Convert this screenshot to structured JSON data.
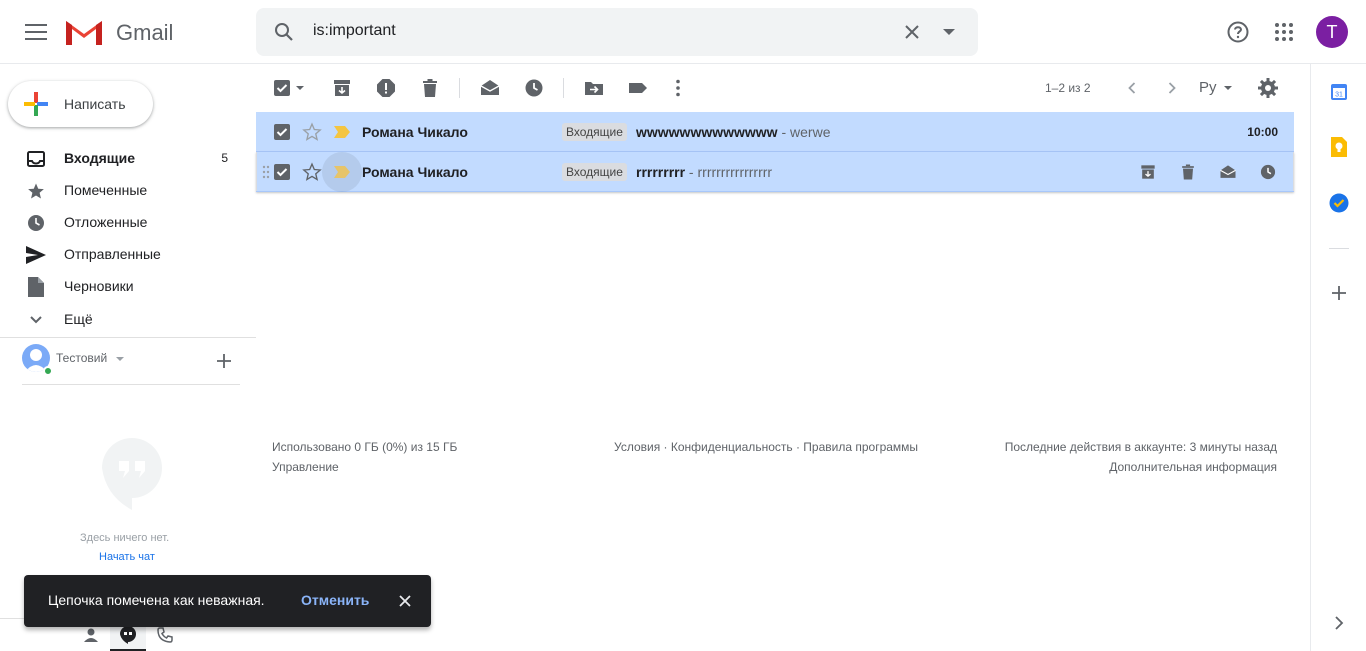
{
  "header": {
    "logo_text": "Gmail",
    "search_value": "is:important",
    "avatar_letter": "T",
    "accent_red": "#ea4335",
    "avatar_color": "#7b1fa2"
  },
  "compose": {
    "label": "Написать"
  },
  "nav": [
    {
      "label": "Входящие",
      "count": "5",
      "icon": "inbox-icon",
      "bold": true
    },
    {
      "label": "Помеченные",
      "count": "",
      "icon": "star-icon"
    },
    {
      "label": "Отложенные",
      "count": "",
      "icon": "clock-icon"
    },
    {
      "label": "Отправленные",
      "count": "",
      "icon": "send-icon"
    },
    {
      "label": "Черновики",
      "count": "",
      "icon": "draft-icon"
    },
    {
      "label": "Ещё",
      "count": "",
      "icon": "chevron-down-icon"
    }
  ],
  "hangouts": {
    "user_name": "Тестовий",
    "empty_text": "Здесь ничего нет.",
    "start_chat": "Начать чат"
  },
  "toolbar": {
    "pagination": "1–2 из 2",
    "language": "Ру"
  },
  "rows": [
    {
      "sender": "Романа Чикало",
      "label": "Входящие",
      "subject": "wwwwwwwwwwwww",
      "snippet": " - werwe",
      "time": "10:00"
    },
    {
      "sender": "Романа Чикало",
      "label": "Входящие",
      "subject": "rrrrrrrrr",
      "snippet": " - rrrrrrrrrrrrrrrr",
      "time": ""
    }
  ],
  "footer": {
    "storage": "Использовано 0 ГБ (0%) из 15 ГБ",
    "manage": "Управление",
    "terms": "Условия",
    "privacy": "Конфиденциальность",
    "policies": "Правила программы",
    "sep": " · ",
    "last_activity": "Последние действия в аккаунте: 3 минуты назад",
    "details": "Дополнительная информация"
  },
  "toast": {
    "message": "Цепочка помечена как неважная.",
    "undo": "Отменить"
  },
  "colors": {
    "selected_row": "#c2dbff",
    "importance_marker": "#f4c542",
    "undo_link": "#8ab4f8"
  }
}
